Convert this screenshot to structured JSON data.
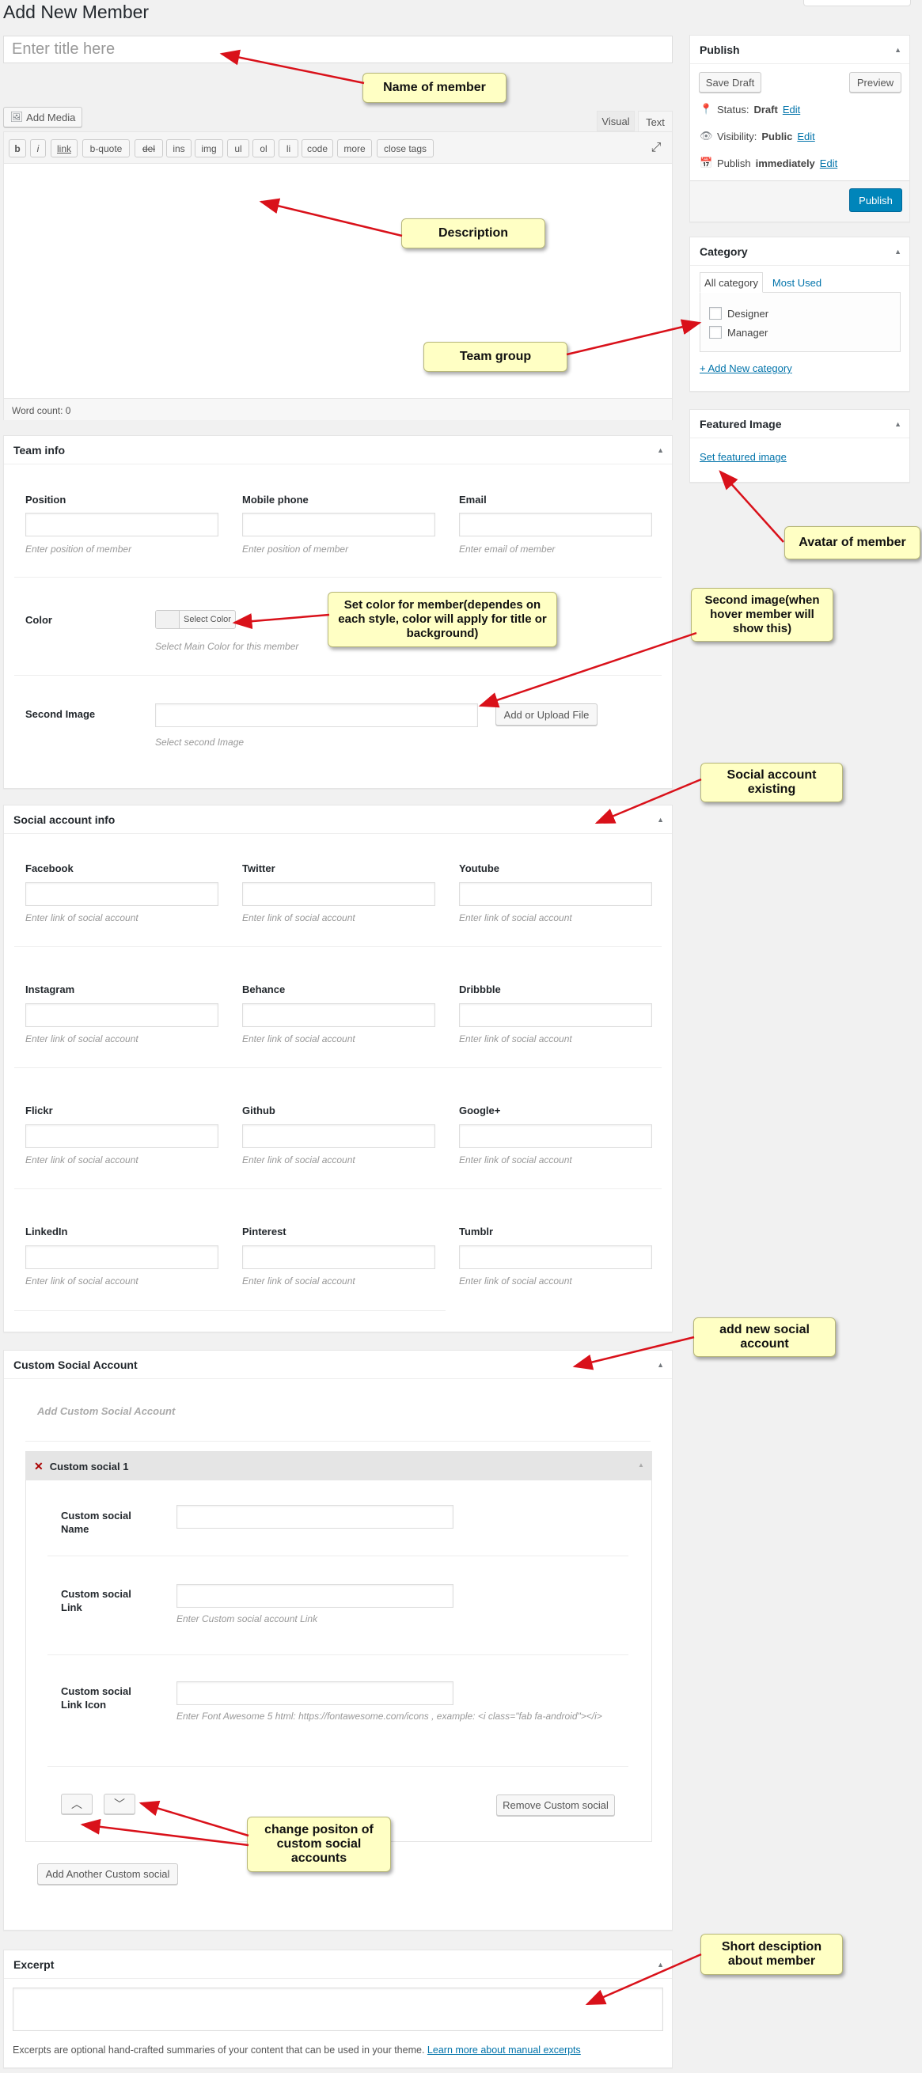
{
  "page": {
    "title": "Add New Member",
    "title_placeholder": "Enter title here"
  },
  "editor": {
    "add_media": "Add Media",
    "tab_visual": "Visual",
    "tab_text": "Text",
    "quicktags": [
      "b",
      "i",
      "link",
      "b-quote",
      "del",
      "ins",
      "img",
      "ul",
      "ol",
      "li",
      "code",
      "more",
      "close tags"
    ],
    "word_count": "Word count: 0"
  },
  "publish": {
    "title": "Publish",
    "save_draft": "Save Draft",
    "preview": "Preview",
    "status_label": "Status:",
    "status_value": "Draft",
    "visibility_label": "Visibility:",
    "visibility_value": "Public",
    "publish_label": "Publish",
    "publish_value": "immediately",
    "edit": "Edit",
    "publish_button": "Publish"
  },
  "category": {
    "title": "Category",
    "tab_all": "All category",
    "tab_most": "Most Used",
    "items": [
      "Designer",
      "Manager"
    ],
    "add_new": "+ Add New category"
  },
  "featured": {
    "title": "Featured Image",
    "link": "Set featured image"
  },
  "team_info": {
    "title": "Team info",
    "position_label": "Position",
    "position_hint": "Enter position of member",
    "mobile_label": "Mobile phone",
    "mobile_hint": "Enter position of member",
    "email_label": "Email",
    "email_hint": "Enter email of member",
    "color_label": "Color",
    "color_button": "Select Color",
    "color_hint": "Select Main Color for this member",
    "second_label": "Second Image",
    "upload_button": "Add or Upload File",
    "second_hint": "Select second Image"
  },
  "social": {
    "title": "Social account info",
    "hint": "Enter link of social account",
    "fields": [
      "Facebook",
      "Twitter",
      "Youtube",
      "Instagram",
      "Behance",
      "Dribbble",
      "Flickr",
      "Github",
      "Google+",
      "LinkedIn",
      "Pinterest",
      "Tumblr"
    ]
  },
  "custom": {
    "title": "Custom Social Account",
    "add_label": "Add Custom Social Account",
    "item_title": "Custom social 1",
    "name_label": "Custom social Name",
    "link_label": "Custom social Link",
    "link_hint": "Enter Custom social account Link",
    "icon_label": "Custom social Link Icon",
    "icon_hint": "Enter Font Awesome 5 html: https://fontawesome.com/icons , example: <i class=\"fab fa-android\"></i>",
    "remove_button": "Remove Custom social",
    "add_another": "Add Another Custom social"
  },
  "excerpt": {
    "title": "Excerpt",
    "help": "Excerpts are optional hand-crafted summaries of your content that can be used in your theme.",
    "help_link": "Learn more about manual excerpts"
  },
  "callouts": {
    "name": "Name of member",
    "description": "Description",
    "team_group": "Team group",
    "avatar": "Avatar of member",
    "second_image": "Second image(when hover member will show this)",
    "color": "Set color for member(dependes on each style, color will apply for title or background)",
    "social_existing": "Social account existing",
    "add_social": "add new social account",
    "change_position": "change positon of custom social accounts",
    "short_desc": "Short desciption about member"
  },
  "colors": {
    "accent": "#0073aa",
    "callout": "#ffffc4",
    "arrow": "#d9111a",
    "publish": "#0085ba"
  }
}
